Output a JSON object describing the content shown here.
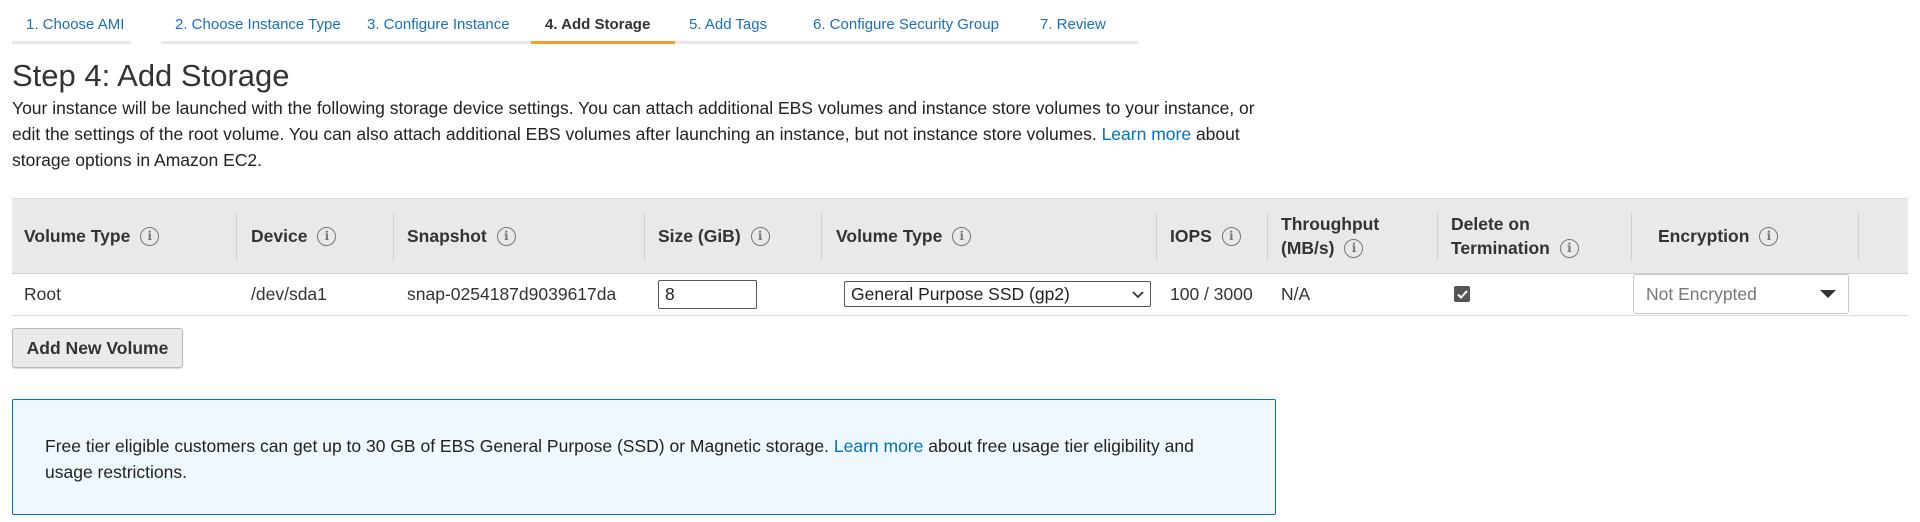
{
  "wizard": {
    "tabs": [
      {
        "label": "1. Choose AMI",
        "active": false
      },
      {
        "label": "2. Choose Instance Type",
        "active": false
      },
      {
        "label": "3. Configure Instance",
        "active": false
      },
      {
        "label": "4. Add Storage",
        "active": true
      },
      {
        "label": "5. Add Tags",
        "active": false
      },
      {
        "label": "6. Configure Security Group",
        "active": false
      },
      {
        "label": "7. Review",
        "active": false
      }
    ],
    "accent_color": "#f39d2f"
  },
  "page": {
    "title": "Step 4: Add Storage",
    "description_part1": "Your instance will be launched with the following storage device settings. You can attach additional EBS volumes and instance store volumes to your instance, or edit the settings of the root volume. You can also attach additional EBS volumes after launching an instance, but not instance store volumes.",
    "learn_more": "Learn more",
    "description_part2": "about storage options in Amazon EC2."
  },
  "table": {
    "headers": {
      "volume_type": "Volume Type",
      "device": "Device",
      "snapshot": "Snapshot",
      "size": "Size (GiB)",
      "volume_type2": "Volume Type",
      "iops": "IOPS",
      "throughput_line1": "Throughput",
      "throughput_line2": "(MB/s)",
      "delete_line1": "Delete on",
      "delete_line2": "Termination",
      "encryption": "Encryption"
    },
    "rows": [
      {
        "volume_type": "Root",
        "device": "/dev/sda1",
        "snapshot": "snap-0254187d9039617da",
        "size": "8",
        "ebs_volume_type": "General Purpose SSD (gp2)",
        "iops": "100 / 3000",
        "throughput": "N/A",
        "delete_on_termination": true,
        "encryption": "Not Encrypted"
      }
    ]
  },
  "add_volume_label": "Add New Volume",
  "notice": {
    "text_part1": "Free tier eligible customers can get up to 30 GB of EBS General Purpose (SSD) or Magnetic storage.",
    "learn_more": "Learn more",
    "text_part2": "about free usage tier eligibility and usage restrictions.",
    "border_color": "#0073bb",
    "background_color": "#f0f8ff"
  },
  "link_color": "#0073bb"
}
